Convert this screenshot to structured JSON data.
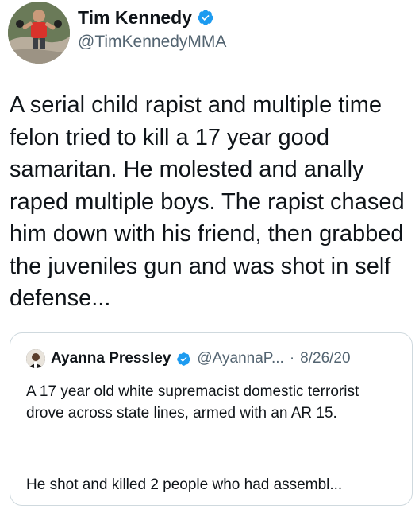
{
  "tweet": {
    "author": {
      "display_name": "Tim Kennedy",
      "handle": "@TimKennedyMMA",
      "avatar_icon": "profile-photo-icon",
      "verified_icon": "verified-badge-icon"
    },
    "text": "A serial child rapist and multiple time felon tried to kill a 17 year good samaritan. He molested and anally raped multiple boys. The rapist chased him down with his friend, then grabbed the juveniles gun and was shot in self defense..."
  },
  "quoted_tweet": {
    "author": {
      "display_name": "Ayanna Pressley",
      "handle": "@AyannaP...",
      "separator": "·",
      "date": "8/26/20",
      "avatar_icon": "profile-photo-icon",
      "verified_icon": "verified-badge-icon"
    },
    "text_paragraph_1": "A 17 year old white supremacist domestic terrorist drove across state lines, armed with an AR 15.",
    "text_paragraph_2": "He shot and killed 2 people who had assembl..."
  },
  "colors": {
    "text_primary": "#0f1419",
    "text_secondary": "#536471",
    "verified_blue": "#1d9bf0",
    "border": "#cfd9de"
  }
}
